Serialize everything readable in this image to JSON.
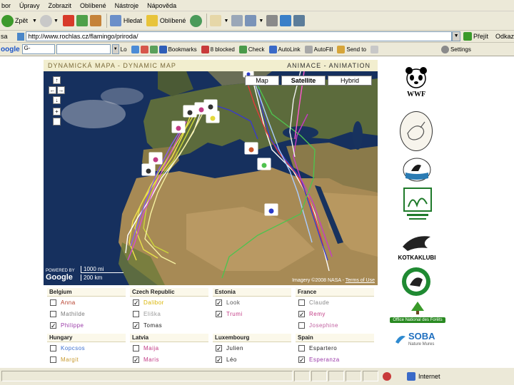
{
  "browser": {
    "menu": [
      "bor",
      "Úpravy",
      "Zobrazit",
      "Oblíbené",
      "Nástroje",
      "Nápověda"
    ],
    "toolbar": {
      "back_label": "Zpět",
      "search_label": "Hledat",
      "favorites_label": "Oblíbené"
    },
    "address": {
      "label": "sa",
      "value": "http://www.rochlas.cz/flamingo/priroda/",
      "go_label": "Přejít",
      "links_label": "Odkaz"
    },
    "google_bar": {
      "logo": "oogle",
      "select_value": "G-",
      "go_label": "Lo",
      "bookmarks_label": "Bookmarks",
      "blocked_label": "8 blocked",
      "check_label": "Check",
      "autolink_label": "AutoLink",
      "autofill_label": "AutoFill",
      "sendto_label": "Send to",
      "settings_label": "Settings"
    },
    "status": {
      "zone": "Internet"
    }
  },
  "map_panel": {
    "title_left": "DYNAMICKÁ MAPA - DYNAMIC MAP",
    "title_right": "ANIMACE - ANIMATION",
    "buttons": {
      "map": "Map",
      "satellite": "Satellite",
      "hybrid": "Hybrid"
    },
    "scale_km": "1000 mi",
    "scale_mi": "200 km",
    "google_logo": "Google",
    "powered_by": "POWERED BY",
    "imagery": "Imagery ©2008 NASA -",
    "terms": "Terms of Use"
  },
  "countries": [
    {
      "name": "Belgium",
      "birds": [
        {
          "name": "Anna",
          "checked": false,
          "color": "#b63c28"
        },
        {
          "name": "Mathilde",
          "checked": false,
          "color": "#7a7a7a"
        },
        {
          "name": "Philippe",
          "checked": true,
          "color": "#9a3aa8"
        }
      ]
    },
    {
      "name": "Czech Republic",
      "birds": [
        {
          "name": "Dalibor",
          "checked": true,
          "color": "#d9b400"
        },
        {
          "name": "Eliška",
          "checked": false,
          "color": "#999999"
        },
        {
          "name": "Tomas",
          "checked": true,
          "color": "#222222"
        }
      ]
    },
    {
      "name": "Estonia",
      "birds": [
        {
          "name": "Look",
          "checked": true,
          "color": "#555555"
        },
        {
          "name": "Trumi",
          "checked": true,
          "color": "#c23b85"
        }
      ]
    },
    {
      "name": "France",
      "birds": [
        {
          "name": "Claude",
          "checked": false,
          "color": "#888888"
        },
        {
          "name": "Remy",
          "checked": true,
          "color": "#c23b85"
        },
        {
          "name": "Josephine",
          "checked": false,
          "color": "#c060a0"
        }
      ]
    },
    {
      "name": "Hungary",
      "birds": [
        {
          "name": "Kopcsos",
          "checked": false,
          "color": "#3b6fd0"
        },
        {
          "name": "Margit",
          "checked": false,
          "color": "#c89a30"
        }
      ]
    },
    {
      "name": "Latvia",
      "birds": [
        {
          "name": "Maija",
          "checked": false,
          "color": "#c23b85"
        },
        {
          "name": "Maris",
          "checked": true,
          "color": "#c23b85"
        }
      ]
    },
    {
      "name": "Luxembourg",
      "birds": [
        {
          "name": "Julien",
          "checked": true,
          "color": "#222222"
        },
        {
          "name": "Léo",
          "checked": true,
          "color": "#222222"
        }
      ]
    },
    {
      "name": "Spain",
      "birds": [
        {
          "name": "Espartero",
          "checked": false,
          "color": "#222222"
        },
        {
          "name": "Esperanza",
          "checked": true,
          "color": "#9a3aa8"
        }
      ]
    }
  ],
  "partners": {
    "wwf": "WWF",
    "kotkaklubi": "KOTKAKLUBI",
    "onf": "Office National des Forêts",
    "soba": "SOBA",
    "soba_sub": "Nature Mures"
  }
}
